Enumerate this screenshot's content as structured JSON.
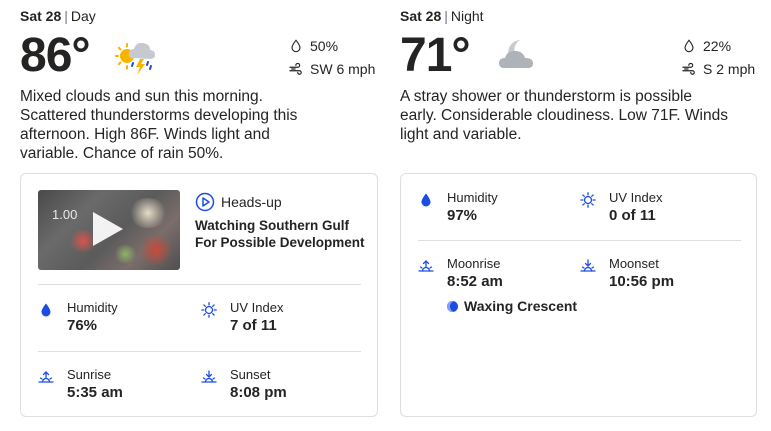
{
  "day": {
    "date": "Sat 28",
    "period": "Day",
    "temperature": "86°",
    "icon": "scattered-thunderstorms-icon",
    "rain_chance": "50%",
    "wind": "SW 6 mph",
    "description": "Mixed clouds and sun this morning. Scattered thunderstorms developing this afternoon. High 86F. Winds light and variable. Chance of rain 50%.",
    "video": {
      "duration": "1.00",
      "label": "Heads-up",
      "headline": "Watching Southern Gulf For Possible Development"
    },
    "humidity": {
      "label": "Humidity",
      "value": "76%"
    },
    "uv_index": {
      "label": "UV Index",
      "value": "7 of 11"
    },
    "sunrise": {
      "label": "Sunrise",
      "value": "5:35 am"
    },
    "sunset": {
      "label": "Sunset",
      "value": "8:08 pm"
    }
  },
  "night": {
    "date": "Sat 28",
    "period": "Night",
    "temperature": "71°",
    "icon": "cloudy-night-icon",
    "rain_chance": "22%",
    "wind": "S 2 mph",
    "description": "A stray shower or thunderstorm is possible early. Considerable cloudiness. Low 71F. Winds light and variable.",
    "humidity": {
      "label": "Humidity",
      "value": "97%"
    },
    "uv_index": {
      "label": "UV Index",
      "value": "0 of 11"
    },
    "moonrise": {
      "label": "Moonrise",
      "value": "8:52 am"
    },
    "moonset": {
      "label": "Moonset",
      "value": "10:56 pm"
    },
    "moon_phase": "Waxing Crescent"
  },
  "colors": {
    "accent_blue": "#1b4de4",
    "text": "#252422",
    "divider": "#dedede"
  }
}
